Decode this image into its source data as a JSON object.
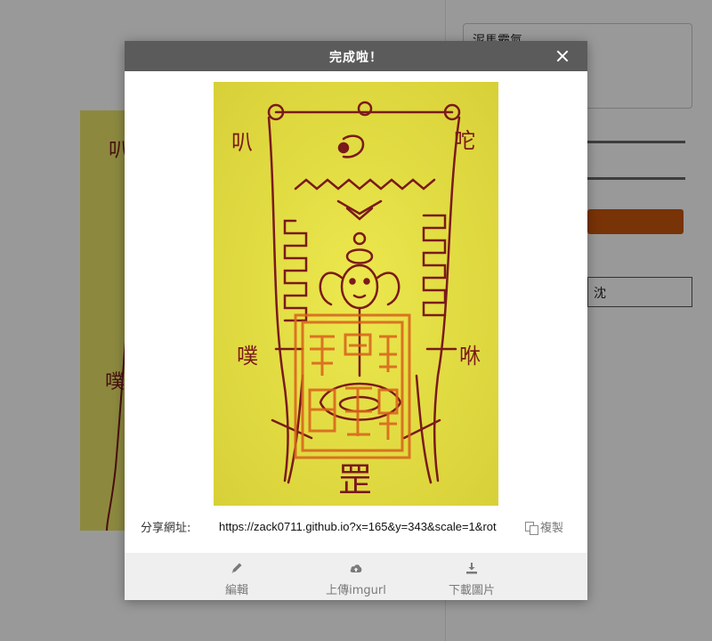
{
  "background": {
    "textarea_value": "泥馬霸氣",
    "outline_button_label": "沈"
  },
  "modal": {
    "title": "完成啦！",
    "close_icon": "close-icon",
    "image_alt": "talisman-image",
    "share": {
      "label": "分享網址:",
      "url": "https://zack0711.github.io?x=165&y=343&scale=1&rot",
      "copy_label": "複製",
      "copy_icon": "copy-icon"
    },
    "footer": {
      "edit_label": "編輯",
      "edit_icon": "pencil-icon",
      "upload_label": "上傳imgurl",
      "upload_icon": "cloud-upload-icon",
      "download_label": "下載圖片",
      "download_icon": "download-icon"
    }
  },
  "talisman_text": {
    "left_top": "叭",
    "right_top": "咜",
    "left_mid": "噗",
    "right_mid": "咻",
    "bottom": "罡"
  },
  "colors": {
    "header_bg": "#5b5b5b",
    "paper": "#e9e247",
    "ink": "#7a1a1a",
    "seal": "#d9641c",
    "accent_button": "#c8560c"
  }
}
